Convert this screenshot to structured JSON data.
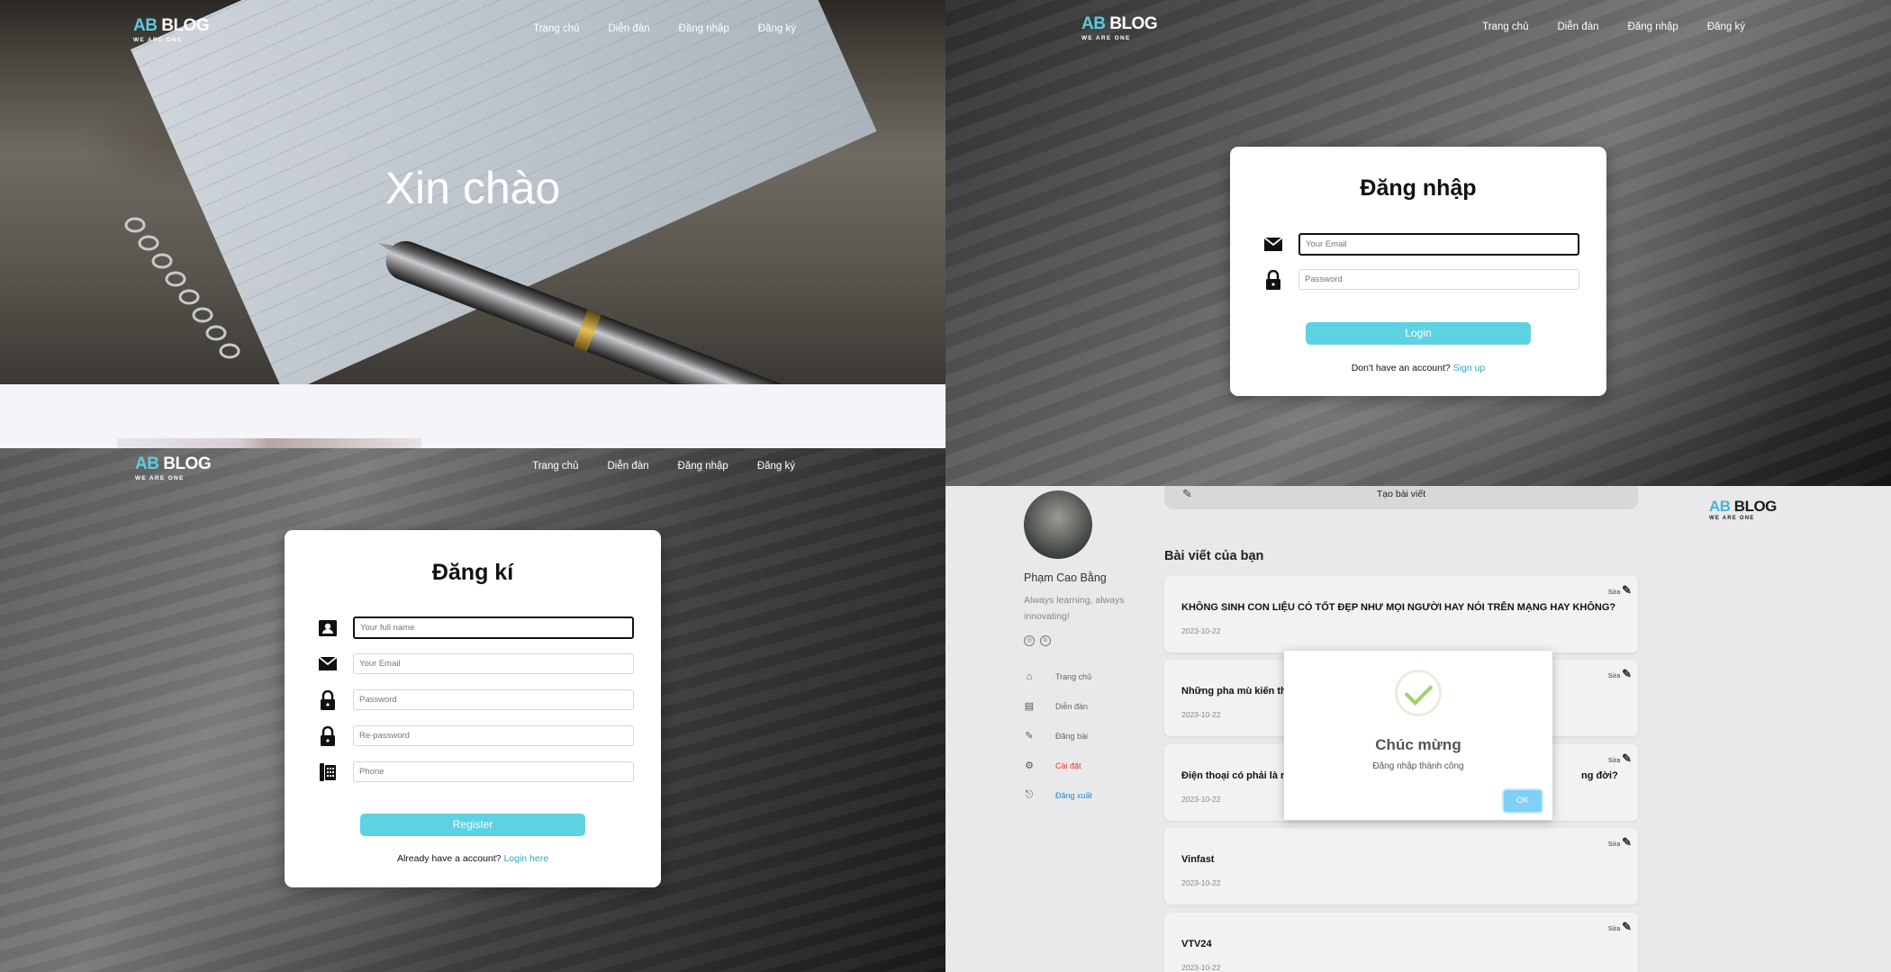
{
  "brand": {
    "ab": "AB",
    "blog": "BLOG",
    "tagline": "WE ARE ONE"
  },
  "nav": [
    "Trang chủ",
    "Diễn đàn",
    "Đăng nhập",
    "Đăng ký"
  ],
  "home": {
    "hero_title": "Xin chào"
  },
  "login": {
    "title": "Đăng nhập",
    "email_placeholder": "Your Email",
    "password_placeholder": "Password",
    "button": "Login",
    "alt_text": "Don't have an account?",
    "alt_link": "Sign up"
  },
  "register": {
    "title": "Đăng kí",
    "fullname_placeholder": "Your full name",
    "email_placeholder": "Your Email",
    "password_placeholder": "Password",
    "repassword_placeholder": "Re-password",
    "phone_placeholder": "Phone",
    "button": "Register",
    "alt_text": "Already have a account?",
    "alt_link": "Login here"
  },
  "dashboard": {
    "create_post": "Tạo bài viết",
    "user_name": "Phạm Cao Bằng",
    "user_bio": "Always learning, always innovating!",
    "sidebar": [
      "Trang chủ",
      "Diễn đàn",
      "Đăng bài",
      "Cài đặt",
      "Đăng xuất"
    ],
    "section_title": "Bài viết của bạn",
    "edit_label": "Sửa",
    "posts": [
      {
        "title": "KHÔNG SINH CON LIỆU CÓ TỐT ĐẸP NHƯ MỌI NGƯỜI HAY NÓI TRÊN MẠNG HAY KHÔNG?",
        "date": "2023-10-22"
      },
      {
        "title": "Những pha mù kiến th",
        "date": "2023-10-22"
      },
      {
        "title": "Điện thoại có phải là n",
        "title_tail": "ng đời?",
        "date": "2023-10-22"
      },
      {
        "title": "Vinfast",
        "date": "2023-10-22"
      },
      {
        "title": "VTV24",
        "date": "2023-10-22"
      }
    ]
  },
  "modal": {
    "title": "Chúc mừng",
    "message": "Đăng nhập thành công",
    "ok": "OK"
  }
}
